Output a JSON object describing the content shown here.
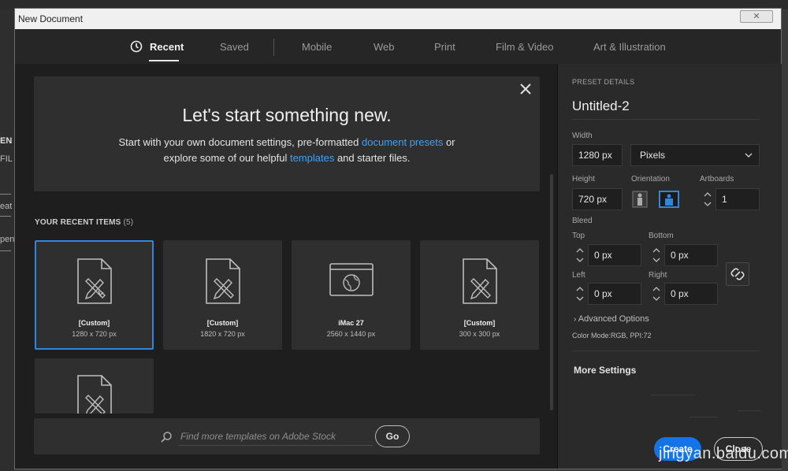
{
  "background_app": {
    "fragments": [
      "EN",
      "FIL",
      "eat",
      "pen"
    ]
  },
  "window": {
    "title": "New Document",
    "close_glyph": "✕"
  },
  "tabs": [
    {
      "label": "Recent",
      "active": true,
      "icon": "clock-icon"
    },
    {
      "label": "Saved",
      "active": false
    },
    {
      "label": "Mobile",
      "active": false
    },
    {
      "label": "Web",
      "active": false
    },
    {
      "label": "Print",
      "active": false
    },
    {
      "label": "Film & Video",
      "active": false
    },
    {
      "label": "Art & Illustration",
      "active": false
    }
  ],
  "hero": {
    "title": "Let's start something new.",
    "line1_prefix": "Start with your own document settings, pre-formatted ",
    "link_presets": "document presets",
    "line1_suffix": " or",
    "line2_prefix": "explore some of our helpful ",
    "link_templates": "templates",
    "line2_suffix": " and starter files."
  },
  "recent": {
    "heading": "YOUR RECENT ITEMS",
    "count": "(5)",
    "items": [
      {
        "name": "[Custom]",
        "dims": "1280 x 720 px",
        "icon": "document-icon",
        "selected": true
      },
      {
        "name": "[Custom]",
        "dims": "1820 x 720 px",
        "icon": "document-icon",
        "selected": false
      },
      {
        "name": "iMac 27",
        "dims": "2560 x 1440 px",
        "icon": "web-icon",
        "selected": false
      },
      {
        "name": "[Custom]",
        "dims": "300 x 300 px",
        "icon": "document-icon",
        "selected": false
      },
      {
        "name": "",
        "dims": "",
        "icon": "document-icon",
        "selected": false
      }
    ]
  },
  "search": {
    "placeholder": "Find more templates on Adobe Stock",
    "go_label": "Go"
  },
  "preset": {
    "section": "PRESET DETAILS",
    "name": "Untitled-2",
    "width_label": "Width",
    "width_value": "1280 px",
    "units_value": "Pixels",
    "height_label": "Height",
    "height_value": "720 px",
    "orientation_label": "Orientation",
    "orientation_selected": "landscape",
    "artboards_label": "Artboards",
    "artboards_value": "1",
    "bleed_label": "Bleed",
    "top_label": "Top",
    "top_value": "0 px",
    "bottom_label": "Bottom",
    "bottom_value": "0 px",
    "left_label": "Left",
    "left_value": "0 px",
    "right_label": "Right",
    "right_value": "0 px",
    "advanced_label": "Advanced Options",
    "color_mode": "Color Mode:RGB, PPI:72",
    "more_settings": "More Settings",
    "create_label": "Create",
    "close_label": "Close"
  },
  "watermark": "jingyan.baidu.com",
  "colors": {
    "accent": "#1473e6",
    "link": "#4a9ee8",
    "selection": "#2e86de"
  }
}
